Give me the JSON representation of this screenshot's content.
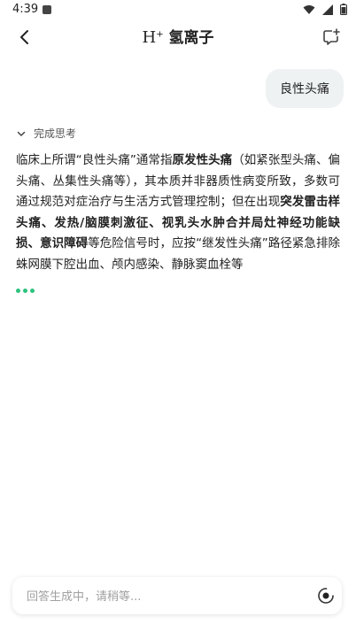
{
  "status_bar": {
    "time": "4:39",
    "icons": [
      "notification-icon",
      "wifi-icon",
      "signal-icon",
      "battery-icon"
    ]
  },
  "header": {
    "logo_h": "H",
    "logo_sup": "+",
    "logo_text": "氢离子",
    "icons": [
      "back-icon",
      "new-chat-icon"
    ]
  },
  "chat": {
    "user_message": "良性头痛",
    "think_label": "完成思考",
    "answer": {
      "t1": "临床上所谓“良性头痛”通常指",
      "b1": "原发性头痛",
      "t2": "（如紧张型头痛、偏头痛、丛集性头痛等），其本质并非器质性病变所致，多数可通过规范对症治疗与生活方式管理控制；但在出现",
      "b2": "突发雷击样头痛、发热/脑膜刺激征、视乳头水肿合并局灶神经功能缺损、意识障碍",
      "t3": "等危险信号时，应按“继发性头痛”路径紧急排除蛛网膜下腔出血、颅内感染、静脉窦血栓等"
    }
  },
  "input": {
    "placeholder": "回答生成中，请稍等..."
  },
  "colors": {
    "accent": "#2ec27e",
    "bubble": "#eef2f3"
  }
}
